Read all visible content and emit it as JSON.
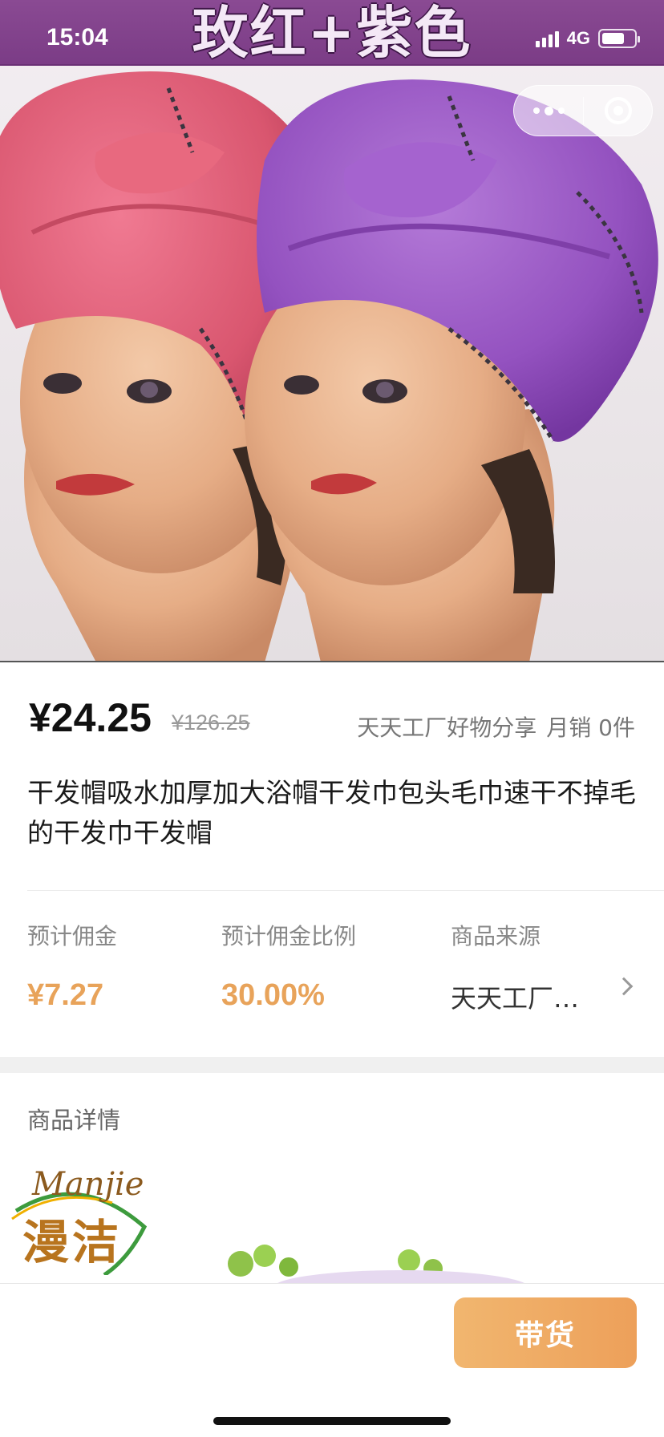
{
  "status_bar": {
    "time": "15:04",
    "network": "4G",
    "battery_level": 0.72
  },
  "hero": {
    "banner_text": "玫红+紫色"
  },
  "capsule": {
    "more_icon": "more-dots-icon",
    "close_icon": "target-close-icon"
  },
  "product": {
    "price": "¥24.25",
    "original_price": "¥126.25",
    "shop_name": "天天工厂好物分享",
    "monthly_sales": "月销 0件",
    "title": "干发帽吸水加厚加大浴帽干发巾包头毛巾速干不掉毛的干发巾干发帽"
  },
  "stats": {
    "commission_label": "预计佣金",
    "commission_value": "¥7.27",
    "rate_label": "预计佣金比例",
    "rate_value": "30.00%",
    "source_label": "商品来源",
    "source_value": "天天工厂…"
  },
  "details": {
    "heading": "商品详情",
    "logo_latin": "Manjie",
    "logo_cn": "漫洁"
  },
  "bottom": {
    "cta_label": "带货"
  },
  "colors": {
    "accent": "#e8a35a",
    "cta_start": "#f1b66f",
    "cta_end": "#eda05a",
    "banner": "#7b3c86"
  }
}
